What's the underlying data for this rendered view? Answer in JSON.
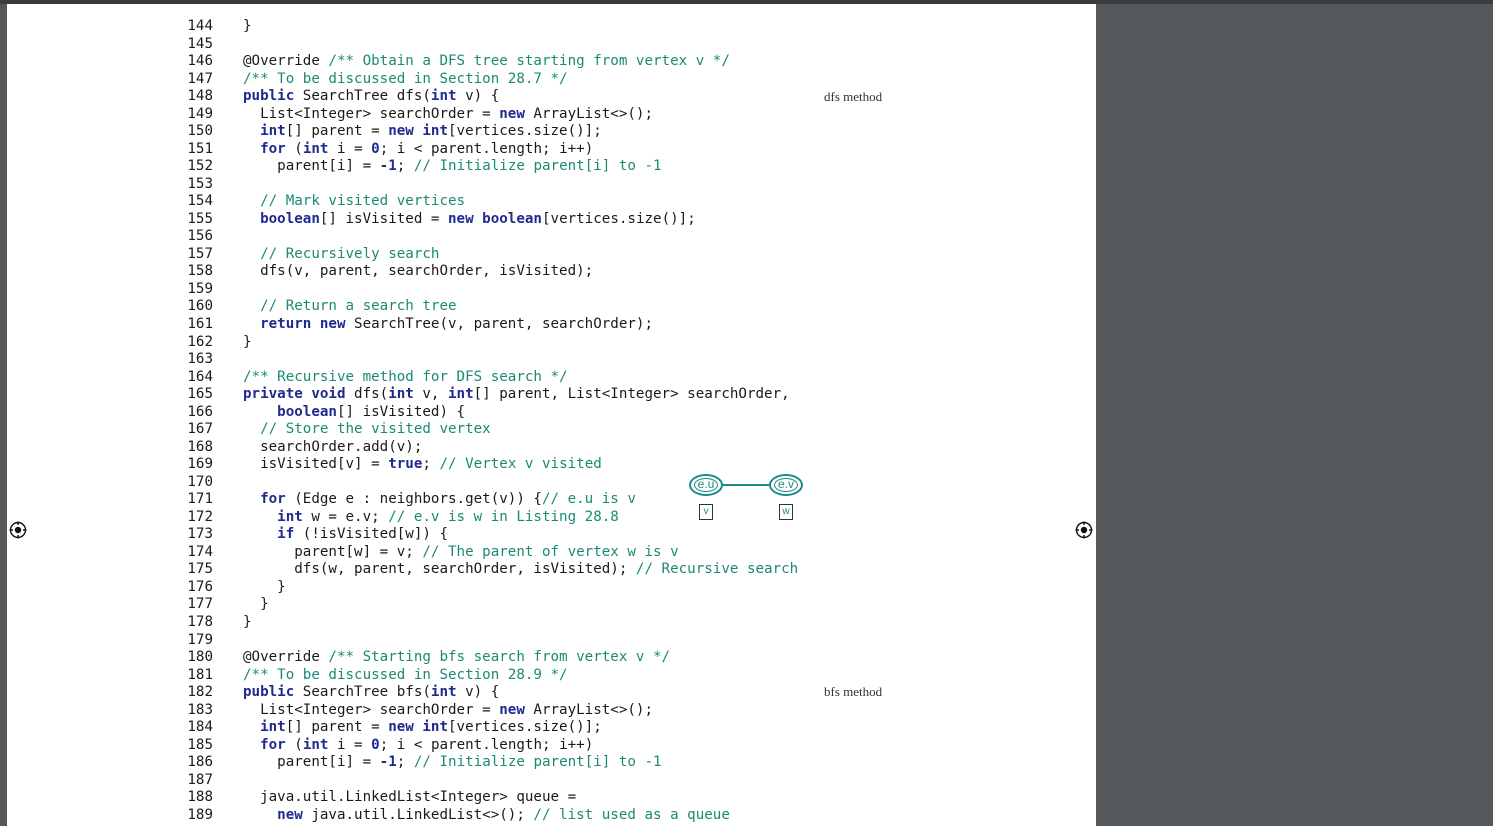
{
  "margin_notes": {
    "dfs_method": "dfs method",
    "bfs_method": "bfs method"
  },
  "diagram": {
    "node_left": "e.u",
    "node_right": "e.v",
    "label_left": "v",
    "label_right": "w"
  },
  "icons": {
    "left_target": "crosshair-target-icon",
    "right_target": "crosshair-target-icon"
  },
  "colors": {
    "keyword": "#1f2a8f",
    "comment": "#1a8a74",
    "diagram": "#1a8a88"
  },
  "code_lines": [
    {
      "n": "144",
      "s": [
        [
          "t",
          "}"
        ]
      ]
    },
    {
      "n": "145",
      "s": []
    },
    {
      "n": "146",
      "s": [
        [
          "t",
          "@Override "
        ],
        [
          "c",
          "/** Obtain a DFS tree starting from vertex v */"
        ]
      ]
    },
    {
      "n": "147",
      "s": [
        [
          "c",
          "/** To be discussed in Section 28.7 */"
        ]
      ]
    },
    {
      "n": "148",
      "s": [
        [
          "k",
          "public"
        ],
        [
          "t",
          " SearchTree dfs("
        ],
        [
          "k",
          "int"
        ],
        [
          "t",
          " v) {"
        ]
      ]
    },
    {
      "n": "149",
      "s": [
        [
          "t",
          "  List<Integer> searchOrder = "
        ],
        [
          "k",
          "new"
        ],
        [
          "t",
          " ArrayList<>();"
        ]
      ]
    },
    {
      "n": "150",
      "s": [
        [
          "t",
          "  "
        ],
        [
          "k",
          "int"
        ],
        [
          "t",
          "[] parent = "
        ],
        [
          "k",
          "new int"
        ],
        [
          "t",
          "[vertices.size()];"
        ]
      ]
    },
    {
      "n": "151",
      "s": [
        [
          "t",
          "  "
        ],
        [
          "k",
          "for"
        ],
        [
          "t",
          " ("
        ],
        [
          "k",
          "int"
        ],
        [
          "t",
          " i = "
        ],
        [
          "n",
          "0"
        ],
        [
          "t",
          "; i < parent.length; i++)"
        ]
      ]
    },
    {
      "n": "152",
      "s": [
        [
          "t",
          "    parent[i] = "
        ],
        [
          "n",
          "-1"
        ],
        [
          "t",
          "; "
        ],
        [
          "c",
          "// Initialize parent[i] to -1"
        ]
      ]
    },
    {
      "n": "153",
      "s": []
    },
    {
      "n": "154",
      "s": [
        [
          "t",
          "  "
        ],
        [
          "c",
          "// Mark visited vertices"
        ]
      ]
    },
    {
      "n": "155",
      "s": [
        [
          "t",
          "  "
        ],
        [
          "k",
          "boolean"
        ],
        [
          "t",
          "[] isVisited = "
        ],
        [
          "k",
          "new boolean"
        ],
        [
          "t",
          "[vertices.size()];"
        ]
      ]
    },
    {
      "n": "156",
      "s": []
    },
    {
      "n": "157",
      "s": [
        [
          "t",
          "  "
        ],
        [
          "c",
          "// Recursively search"
        ]
      ]
    },
    {
      "n": "158",
      "s": [
        [
          "t",
          "  dfs(v, parent, searchOrder, isVisited);"
        ]
      ]
    },
    {
      "n": "159",
      "s": []
    },
    {
      "n": "160",
      "s": [
        [
          "t",
          "  "
        ],
        [
          "c",
          "// Return a search tree"
        ]
      ]
    },
    {
      "n": "161",
      "s": [
        [
          "t",
          "  "
        ],
        [
          "k",
          "return new"
        ],
        [
          "t",
          " SearchTree(v, parent, searchOrder);"
        ]
      ]
    },
    {
      "n": "162",
      "s": [
        [
          "t",
          "}"
        ]
      ]
    },
    {
      "n": "163",
      "s": []
    },
    {
      "n": "164",
      "s": [
        [
          "c",
          "/** Recursive method for DFS search */"
        ]
      ]
    },
    {
      "n": "165",
      "s": [
        [
          "k",
          "private void"
        ],
        [
          "t",
          " dfs("
        ],
        [
          "k",
          "int"
        ],
        [
          "t",
          " v, "
        ],
        [
          "k",
          "int"
        ],
        [
          "t",
          "[] parent, List<Integer> searchOrder,"
        ]
      ]
    },
    {
      "n": "166",
      "s": [
        [
          "t",
          "    "
        ],
        [
          "k",
          "boolean"
        ],
        [
          "t",
          "[] isVisited) {"
        ]
      ]
    },
    {
      "n": "167",
      "s": [
        [
          "t",
          "  "
        ],
        [
          "c",
          "// Store the visited vertex"
        ]
      ]
    },
    {
      "n": "168",
      "s": [
        [
          "t",
          "  searchOrder.add(v);"
        ]
      ]
    },
    {
      "n": "169",
      "s": [
        [
          "t",
          "  isVisited[v] = "
        ],
        [
          "k",
          "true"
        ],
        [
          "t",
          "; "
        ],
        [
          "c",
          "// Vertex v visited"
        ]
      ]
    },
    {
      "n": "170",
      "s": []
    },
    {
      "n": "171",
      "s": [
        [
          "t",
          "  "
        ],
        [
          "k",
          "for"
        ],
        [
          "t",
          " (Edge e : neighbors.get(v)) {"
        ],
        [
          "c",
          "// e.u is v"
        ]
      ]
    },
    {
      "n": "172",
      "s": [
        [
          "t",
          "    "
        ],
        [
          "k",
          "int"
        ],
        [
          "t",
          " w = e.v; "
        ],
        [
          "c",
          "// e.v is w in Listing 28.8"
        ]
      ]
    },
    {
      "n": "173",
      "s": [
        [
          "t",
          "    "
        ],
        [
          "k",
          "if"
        ],
        [
          "t",
          " (!isVisited[w]) {"
        ]
      ]
    },
    {
      "n": "174",
      "s": [
        [
          "t",
          "      parent[w] = v; "
        ],
        [
          "c",
          "// The parent of vertex w is v"
        ]
      ]
    },
    {
      "n": "175",
      "s": [
        [
          "t",
          "      dfs(w, parent, searchOrder, isVisited); "
        ],
        [
          "c",
          "// Recursive search"
        ]
      ]
    },
    {
      "n": "176",
      "s": [
        [
          "t",
          "    }"
        ]
      ]
    },
    {
      "n": "177",
      "s": [
        [
          "t",
          "  }"
        ]
      ]
    },
    {
      "n": "178",
      "s": [
        [
          "t",
          "}"
        ]
      ]
    },
    {
      "n": "179",
      "s": []
    },
    {
      "n": "180",
      "s": [
        [
          "t",
          "@Override "
        ],
        [
          "c",
          "/** Starting bfs search from vertex v */"
        ]
      ]
    },
    {
      "n": "181",
      "s": [
        [
          "c",
          "/** To be discussed in Section 28.9 */"
        ]
      ]
    },
    {
      "n": "182",
      "s": [
        [
          "k",
          "public"
        ],
        [
          "t",
          " SearchTree bfs("
        ],
        [
          "k",
          "int"
        ],
        [
          "t",
          " v) {"
        ]
      ]
    },
    {
      "n": "183",
      "s": [
        [
          "t",
          "  List<Integer> searchOrder = "
        ],
        [
          "k",
          "new"
        ],
        [
          "t",
          " ArrayList<>();"
        ]
      ]
    },
    {
      "n": "184",
      "s": [
        [
          "t",
          "  "
        ],
        [
          "k",
          "int"
        ],
        [
          "t",
          "[] parent = "
        ],
        [
          "k",
          "new int"
        ],
        [
          "t",
          "[vertices.size()];"
        ]
      ]
    },
    {
      "n": "185",
      "s": [
        [
          "t",
          "  "
        ],
        [
          "k",
          "for"
        ],
        [
          "t",
          " ("
        ],
        [
          "k",
          "int"
        ],
        [
          "t",
          " i = "
        ],
        [
          "n",
          "0"
        ],
        [
          "t",
          "; i < parent.length; i++)"
        ]
      ]
    },
    {
      "n": "186",
      "s": [
        [
          "t",
          "    parent[i] = "
        ],
        [
          "n",
          "-1"
        ],
        [
          "t",
          "; "
        ],
        [
          "c",
          "// Initialize parent[i] to -1"
        ]
      ]
    },
    {
      "n": "187",
      "s": []
    },
    {
      "n": "188",
      "s": [
        [
          "t",
          "  java.util.LinkedList<Integer> queue ="
        ]
      ]
    },
    {
      "n": "189",
      "s": [
        [
          "t",
          "    "
        ],
        [
          "k",
          "new"
        ],
        [
          "t",
          " java.util.LinkedList<>(); "
        ],
        [
          "c",
          "// list used as a queue"
        ]
      ]
    }
  ]
}
